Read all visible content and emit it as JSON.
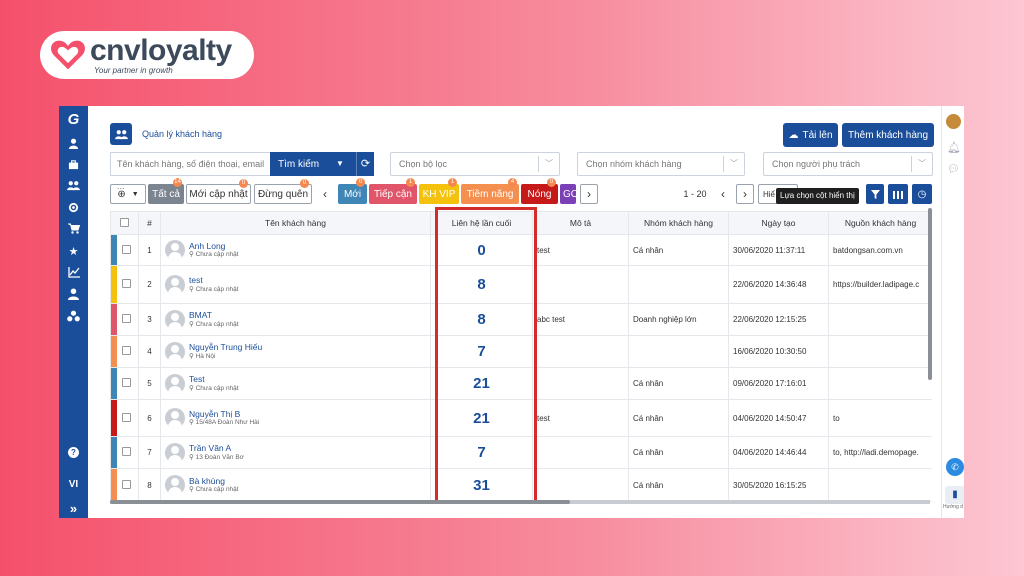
{
  "brand": {
    "name": "cnvloyalty",
    "tagline": "Your partner in growth",
    "color": "#3d4a5c",
    "heart_color": "#f5506b"
  },
  "sidebar": {
    "icons": [
      "logo-g-icon",
      "user-icon",
      "briefcase-icon",
      "users-icon",
      "target-icon",
      "cart-icon",
      "star-icon",
      "chart-icon",
      "user-tie-icon",
      "network-icon"
    ],
    "help": "?",
    "lang": "VI",
    "expand": "»"
  },
  "header": {
    "page_title": "Quản lý khách hàng",
    "upload_label": "Tải lên",
    "add_label": "Thêm khách hàng"
  },
  "search": {
    "placeholder": "Tên khách hàng, số điện thoại, email ...",
    "button": "Tìm kiếm",
    "filter_placeholder": "Chọn bộ lọc",
    "group_placeholder": "Chọn nhóm khách hàng",
    "owner_placeholder": "Chọn người phụ trách"
  },
  "tags": {
    "all": {
      "label": "Tất cả",
      "count": "14"
    },
    "recent": {
      "label": "Mới cập nhật",
      "count": "0"
    },
    "forgot": {
      "label": "Đừng quên",
      "count": "0"
    },
    "stages": [
      {
        "label": "Mới",
        "color": "#3f86b6",
        "count": "0"
      },
      {
        "label": "Tiếp cận",
        "color": "#e0556a",
        "count": "1"
      },
      {
        "label": "KH VIP",
        "color": "#f4c20d",
        "count": "1"
      },
      {
        "label": "Tiềm năng",
        "color": "#f58f4f",
        "count": "4"
      },
      {
        "label": "Nóng",
        "color": "#c61a1a",
        "count": "0"
      },
      {
        "label": "GO",
        "color": "#7b3fb6",
        "count": ""
      }
    ]
  },
  "pagination": {
    "range": "1 - 20",
    "view_label": "Hiể"
  },
  "tooltip": "Lựa chọn cột hiển thị",
  "table": {
    "headers": [
      "#",
      "Tên khách hàng",
      "Liên hệ lần cuối",
      "Mô tả",
      "Nhóm khách hàng",
      "Ngày tạo",
      "Nguồn khách hàng"
    ],
    "rows": [
      {
        "no": "1",
        "name": "Anh Long",
        "addr": "Chưa cập nhật",
        "last": "0",
        "desc": "test",
        "group": "Cá nhân",
        "created": "30/06/2020 11:37:11",
        "source": "batdongsan.com.vn",
        "stripe": "#3f86b6"
      },
      {
        "no": "2",
        "name": "test",
        "addr": "Chưa cập nhật",
        "last": "8",
        "desc": "",
        "group": "",
        "created": "22/06/2020 14:36:48",
        "source": "https://builder.ladipage.c",
        "stripe": "#f4c20d"
      },
      {
        "no": "3",
        "name": "BMAT",
        "addr": "Chưa cập nhật",
        "last": "8",
        "desc": "abc test",
        "group": "Doanh nghiệp lớn",
        "created": "22/06/2020 12:15:25",
        "source": "",
        "stripe": "#e0556a"
      },
      {
        "no": "4",
        "name": "Nguyễn Trung Hiếu",
        "addr": "Hà Nội",
        "last": "7",
        "desc": "",
        "group": "",
        "created": "16/06/2020 10:30:50",
        "source": "",
        "stripe": "#f58f4f"
      },
      {
        "no": "5",
        "name": "Test",
        "addr": "Chưa cập nhật",
        "last": "21",
        "desc": "",
        "group": "Cá nhân",
        "created": "09/06/2020 17:16:01",
        "source": "",
        "stripe": "#3f86b6"
      },
      {
        "no": "6",
        "name": "Nguyễn Thị B",
        "addr": "15/48A Đoàn Như Hài",
        "last": "21",
        "desc": "test",
        "group": "Cá nhân",
        "created": "04/06/2020 14:50:47",
        "source": "to",
        "stripe": "#c61a1a"
      },
      {
        "no": "7",
        "name": "Trần Văn A",
        "addr": "13 Đoàn Văn Bơ",
        "last": "7",
        "desc": "",
        "group": "Cá nhân",
        "created": "04/06/2020 14:46:44",
        "source": "to, http://ladi.demopage.",
        "stripe": "#3f86b6"
      },
      {
        "no": "8",
        "name": "Bà khùng",
        "addr": "Chưa cập nhật",
        "last": "31",
        "desc": "",
        "group": "Cá nhân",
        "created": "30/05/2020 16:15:25",
        "source": "",
        "stripe": "#f58f4f"
      }
    ]
  },
  "rightbar": {
    "help_label": "Hướng d"
  }
}
